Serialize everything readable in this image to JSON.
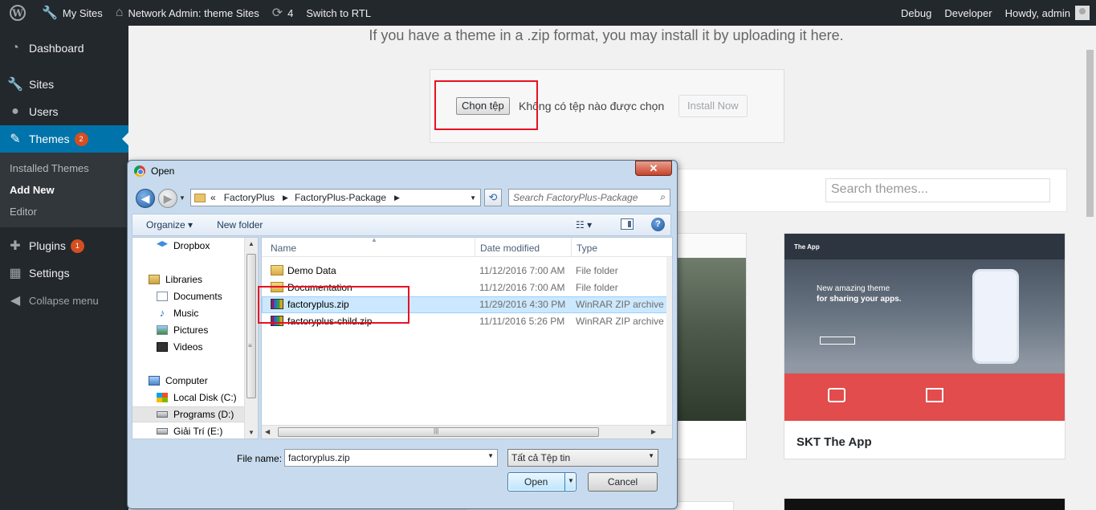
{
  "adminbar": {
    "my_sites": "My Sites",
    "network_admin": "Network Admin: theme Sites",
    "updates_count": "4",
    "switch_rtl": "Switch to RTL",
    "debug": "Debug",
    "developer": "Developer",
    "howdy": "Howdy, admin"
  },
  "sidebar": {
    "dashboard": "Dashboard",
    "sites": "Sites",
    "users": "Users",
    "themes": "Themes",
    "themes_badge": "2",
    "installed_themes": "Installed Themes",
    "add_new": "Add New",
    "editor": "Editor",
    "plugins": "Plugins",
    "plugins_badge": "1",
    "settings": "Settings",
    "collapse": "Collapse menu"
  },
  "upload": {
    "intro": "If you have a theme in a .zip format, you may install it by uploading it here.",
    "choose_file": "Chọn tệp",
    "no_file": "Không có tệp nào được chọn",
    "install_now": "Install Now"
  },
  "themes_list": {
    "search_placeholder": "Search themes...",
    "themes": [
      {
        "name": "SKT The App",
        "headline": "New amazing theme",
        "subline": "for sharing your apps.",
        "logo": "The App"
      }
    ]
  },
  "dialog": {
    "title": "Open",
    "path": [
      "«",
      "FactoryPlus",
      "FactoryPlus-Package"
    ],
    "search_placeholder": "Search FactoryPlus-Package",
    "organize": "Organize",
    "new_folder": "New folder",
    "nav_items": [
      {
        "label": "Dropbox",
        "icon": "dropbox-icon"
      },
      {
        "label": "Libraries",
        "icon": "libraries-icon"
      },
      {
        "label": "Documents",
        "icon": "documents-icon"
      },
      {
        "label": "Music",
        "icon": "music-icon"
      },
      {
        "label": "Pictures",
        "icon": "pictures-icon"
      },
      {
        "label": "Videos",
        "icon": "videos-icon"
      },
      {
        "label": "Computer",
        "icon": "computer-icon"
      },
      {
        "label": "Local Disk (C:)",
        "icon": "drive-icon"
      },
      {
        "label": "Programs (D:)",
        "icon": "drive-icon"
      },
      {
        "label": "Giải Trí (E:)",
        "icon": "drive-icon"
      }
    ],
    "columns": {
      "name": "Name",
      "date": "Date modified",
      "type": "Type"
    },
    "files": [
      {
        "name": "Demo Data",
        "date": "11/12/2016 7:00 AM",
        "type": "File folder"
      },
      {
        "name": "Documentation",
        "date": "11/12/2016 7:00 AM",
        "type": "File folder"
      },
      {
        "name": "factoryplus.zip",
        "date": "11/29/2016 4:30 PM",
        "type": "WinRAR ZIP archive"
      },
      {
        "name": "factoryplus-child.zip",
        "date": "11/11/2016 5:26 PM",
        "type": "WinRAR ZIP archive"
      }
    ],
    "file_name_label": "File name:",
    "file_name_value": "factoryplus.zip",
    "file_type": "Tất cả Tệp tin",
    "open": "Open",
    "cancel": "Cancel"
  },
  "colors": {
    "admin_dark": "#23282d",
    "accent_blue": "#0073aa",
    "badge_orange": "#d54e21",
    "highlight_red": "#e81123",
    "selection_blue": "#cce8ff"
  }
}
